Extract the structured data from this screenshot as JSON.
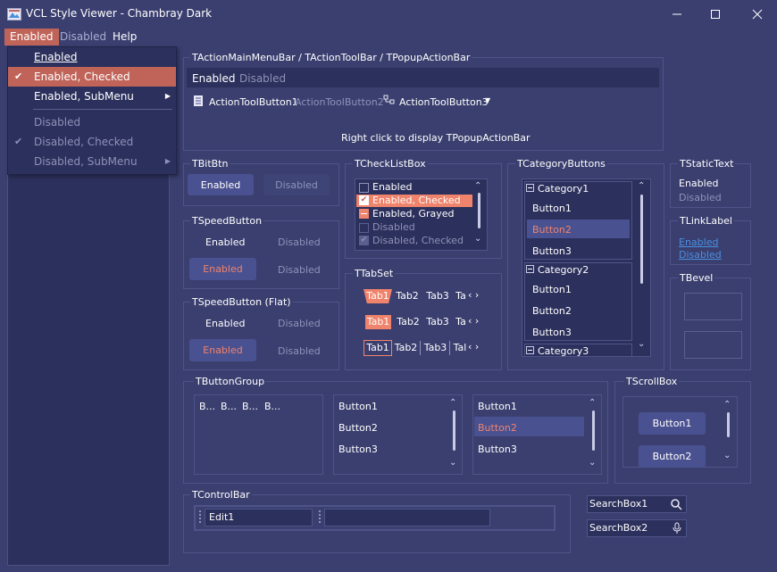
{
  "window": {
    "title": "VCL Style Viewer - Chambray Dark",
    "icon": "app-icon"
  },
  "menubar": {
    "items": [
      "Enabled",
      "Disabled",
      "Help"
    ]
  },
  "popup_menu": {
    "items": [
      {
        "label": "Enabled"
      },
      {
        "label": "Enabled, Checked",
        "checked": true,
        "highlighted": true
      },
      {
        "label": "Enabled, SubMenu",
        "submenu": true
      },
      {
        "label": "Disabled",
        "disabled": true
      },
      {
        "label": "Disabled, Checked",
        "checked": true,
        "disabled": true
      },
      {
        "label": "Disabled, SubMenu",
        "submenu": true,
        "disabled": true
      }
    ]
  },
  "action_bar": {
    "title": "TActionMainMenuBar / TActionToolBar / TPopupActionBar",
    "menu_items": [
      "Enabled",
      "Disabled"
    ],
    "toolbar": [
      "ActionToolButton1",
      "ActionToolButton2",
      "ActionToolButton3"
    ],
    "hint": "Right click to display TPopupActionBar"
  },
  "bitbtn": {
    "title": "TBitBtn",
    "enabled": "Enabled",
    "disabled": "Disabled"
  },
  "speedbutton": {
    "title": "TSpeedButton",
    "labels": [
      "Enabled",
      "Disabled",
      "Enabled",
      "Disabled"
    ]
  },
  "speedbutton_flat": {
    "title": "TSpeedButton (Flat)",
    "labels": [
      "Enabled",
      "Disabled",
      "Enabled",
      "Disabled"
    ]
  },
  "checklistbox": {
    "title": "TCheckListBox",
    "items": [
      "Enabled",
      "Enabled, Checked",
      "Enabled, Grayed",
      "Disabled",
      "Disabled, Checked"
    ]
  },
  "tabset": {
    "title": "TTabSet",
    "tabs": [
      "Tab1",
      "Tab2",
      "Tab3",
      "Ta",
      "Tab1",
      "Tab2",
      "Tab3",
      "Ta",
      "Tab1",
      "Tab2",
      "Tab3",
      "Tal"
    ]
  },
  "categorybuttons": {
    "title": "TCategoryButtons",
    "categories": [
      "Category1",
      "Category2",
      "Category3"
    ],
    "buttons": [
      "Button1",
      "Button2",
      "Button3",
      "Button1",
      "Button2",
      "Button3"
    ]
  },
  "statictext": {
    "title": "TStaticText",
    "enabled": "Enabled",
    "disabled": "Disabled"
  },
  "linklabel": {
    "title": "TLinkLabel",
    "enabled": "Enabled",
    "disabled": "Disabled"
  },
  "bevel": {
    "title": "TBevel"
  },
  "buttongroup": {
    "title": "TButtonGroup",
    "small": [
      "B...",
      "B...",
      "B...",
      "B..."
    ],
    "list1": [
      "Button1",
      "Button2",
      "Button3"
    ],
    "list2": [
      "Button1",
      "Button2",
      "Button3"
    ]
  },
  "scrollbox": {
    "title": "TScrollBox",
    "buttons": [
      "Button1",
      "Button2"
    ]
  },
  "controlbar": {
    "title": "TControlBar",
    "edit": "Edit1"
  },
  "searchboxes": {
    "box1": "SearchBox1",
    "box2": "SearchBox2"
  },
  "colors": {
    "accent": "#f0836b",
    "highlight": "#c0645a",
    "background": "#3a3f6f",
    "panel": "#2c305c"
  }
}
